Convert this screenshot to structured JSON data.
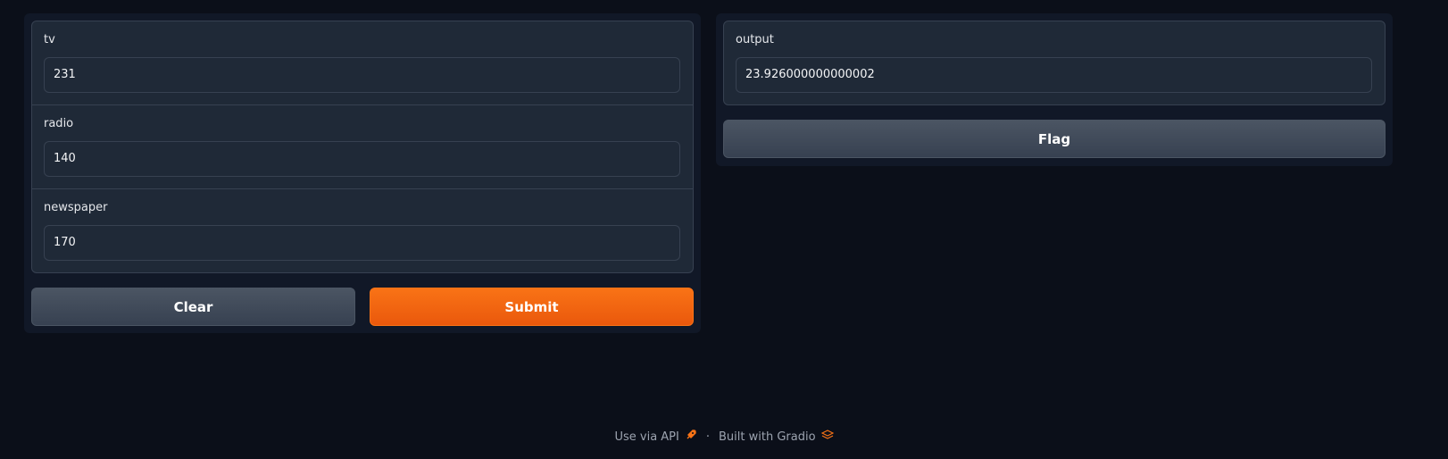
{
  "inputs": {
    "tv": {
      "label": "tv",
      "value": "231"
    },
    "radio": {
      "label": "radio",
      "value": "140"
    },
    "newspaper": {
      "label": "newspaper",
      "value": "170"
    }
  },
  "buttons": {
    "clear": "Clear",
    "submit": "Submit",
    "flag": "Flag"
  },
  "output": {
    "label": "output",
    "value": "23.926000000000002"
  },
  "footer": {
    "api_link": "Use via API",
    "separator": "·",
    "built_with": "Built with Gradio"
  },
  "colors": {
    "background": "#0b0f19",
    "panel": "#111827",
    "block": "#1f2937",
    "border": "#374151",
    "primary": "#f97316",
    "secondary": "#4b5563"
  },
  "icons": [
    "rocket-icon",
    "gradio-logo-icon"
  ]
}
